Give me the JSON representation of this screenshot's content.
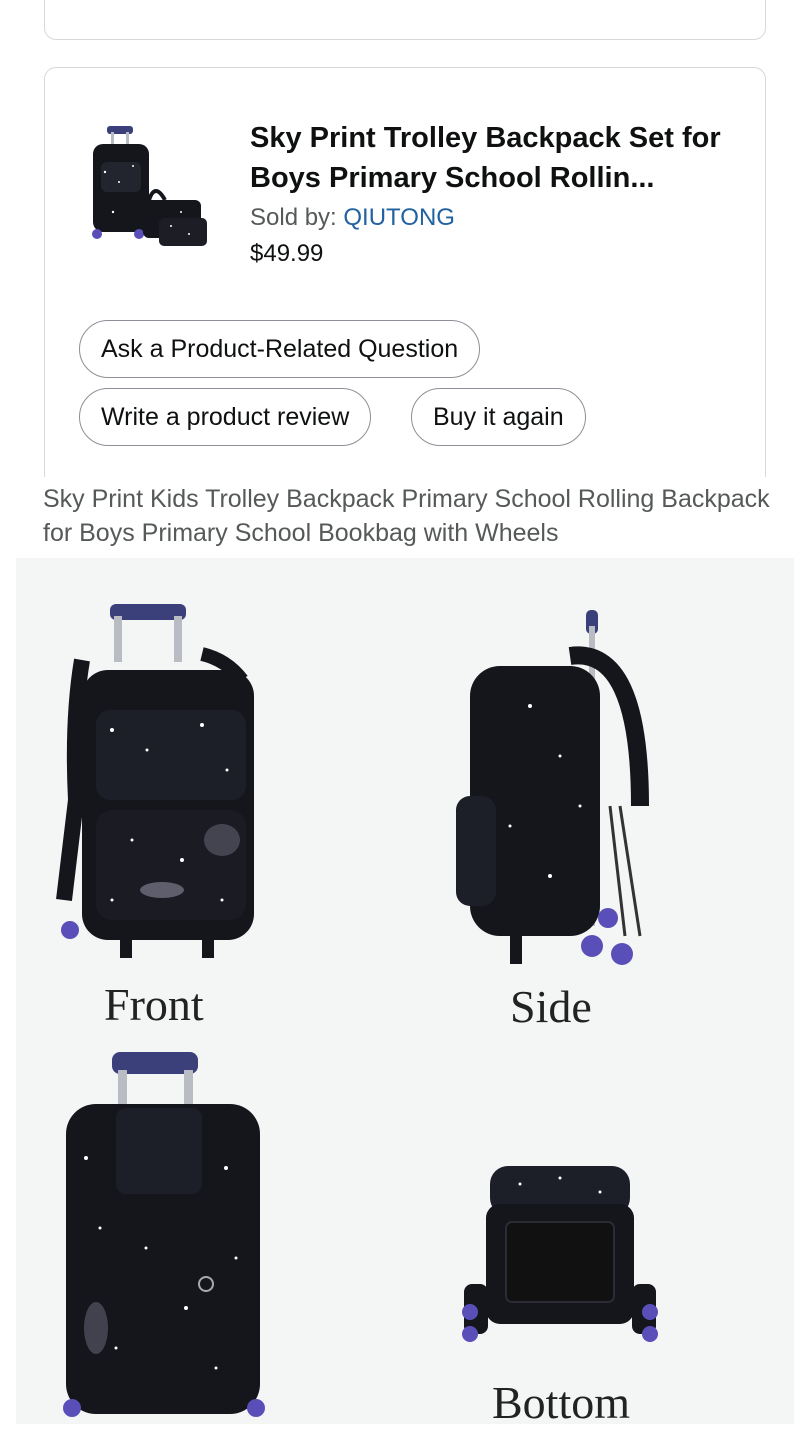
{
  "product": {
    "title": "Sky Print Trolley Backpack Set for Boys Primary School Rollin...",
    "seller_prefix": "Sold by: ",
    "seller_name": "QIUTONG",
    "price": "$49.99",
    "thumbnail_icon": "backpack-thumbnail-icon"
  },
  "actions": {
    "ask_question": "Ask a Product-Related Question",
    "write_review": "Write a product review",
    "buy_again": "Buy it again"
  },
  "description": "Sky Print Kids Trolley Backpack Primary School Rolling Backpack for Boys Primary School Bookbag with Wheels",
  "gallery": {
    "labels": {
      "front": "Front",
      "side": "Side",
      "bottom": "Bottom"
    },
    "colors": {
      "bag": "#15161c",
      "wheel": "#5a4fb8",
      "handle": "#b9bcc3",
      "background": "#f4f5f5"
    }
  }
}
